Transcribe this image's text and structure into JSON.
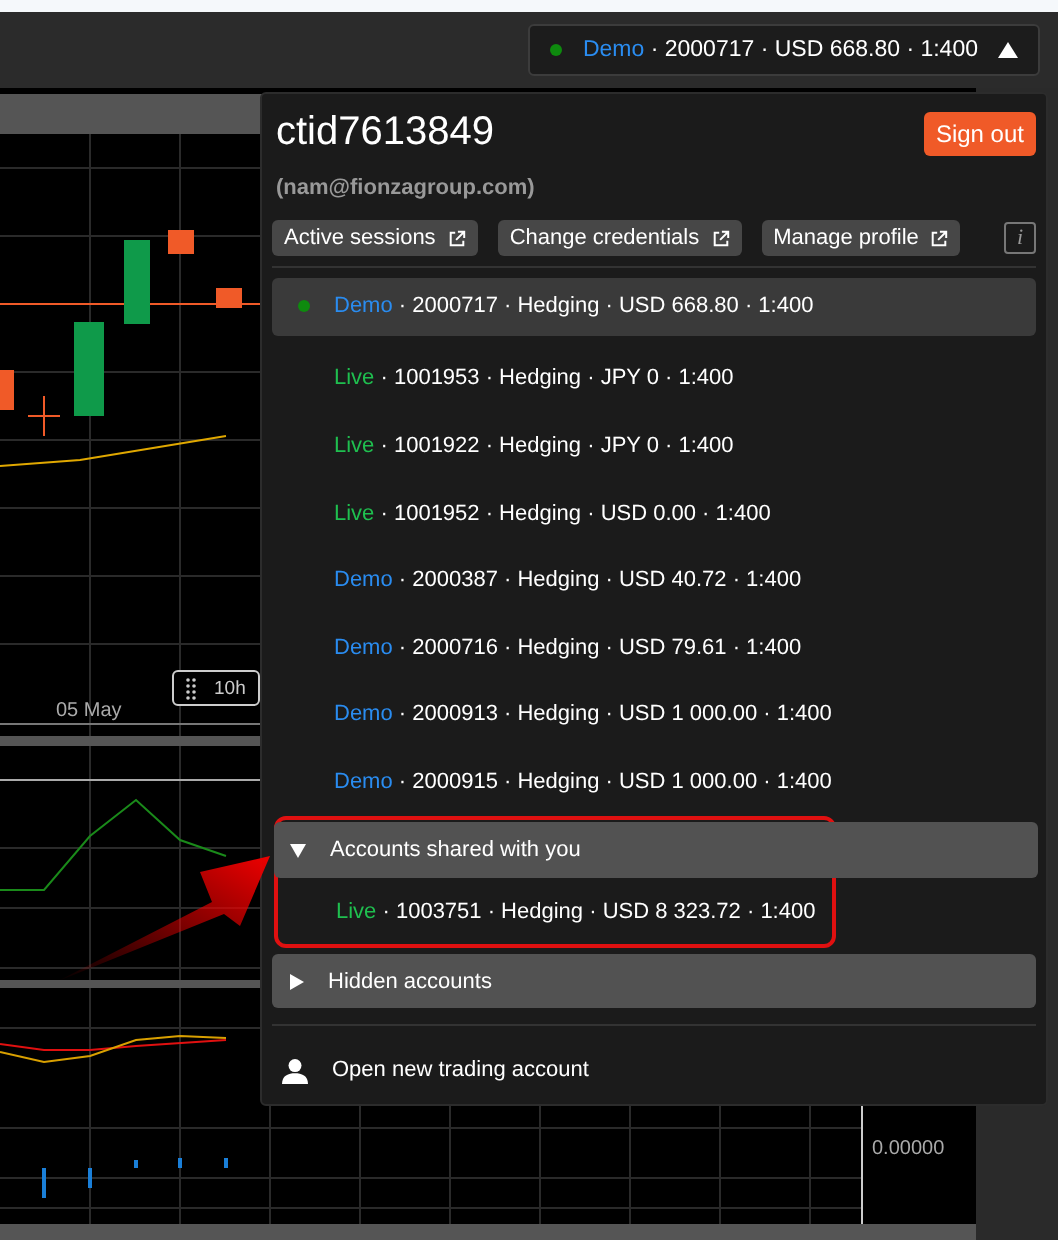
{
  "account_button": {
    "type": "Demo",
    "kind": "demo",
    "details": "· 2000717 · USD 668.80 · 1:400",
    "connected": true,
    "expanded": true
  },
  "profile": {
    "title": "ctid7613849",
    "email": "(nam@fionzagroup.com)",
    "sign_out": "Sign out",
    "links": [
      "Active sessions",
      "Change credentials",
      "Manage profile"
    ],
    "info": "i"
  },
  "accounts": [
    {
      "type": "Demo",
      "kind": "demo",
      "details": "· 2000717 · Hedging · USD 668.80 · 1:400",
      "selected": true
    },
    {
      "type": "Live",
      "kind": "live",
      "details": "· 1001953 · Hedging · JPY 0 · 1:400",
      "selected": false
    },
    {
      "type": "Live",
      "kind": "live",
      "details": "· 1001922 · Hedging · JPY 0 · 1:400",
      "selected": false
    },
    {
      "type": "Live",
      "kind": "live",
      "details": "· 1001952 · Hedging · USD 0.00 · 1:400",
      "selected": false
    },
    {
      "type": "Demo",
      "kind": "demo",
      "details": "· 2000387 · Hedging · USD 40.72 · 1:400",
      "selected": false
    },
    {
      "type": "Demo",
      "kind": "demo",
      "details": "· 2000716 · Hedging · USD 79.61 · 1:400",
      "selected": false
    },
    {
      "type": "Demo",
      "kind": "demo",
      "details": "· 2000913 · Hedging · USD 1 000.00 · 1:400",
      "selected": false
    },
    {
      "type": "Demo",
      "kind": "demo",
      "details": "· 2000915 · Hedging · USD 1 000.00 · 1:400",
      "selected": false
    }
  ],
  "sections": [
    {
      "label": "Accounts shared with you",
      "expanded": true,
      "accounts": [
        {
          "type": "Live",
          "kind": "live",
          "details": "· 1003751 · Hedging · USD 8 323.72 · 1:400",
          "selected": false
        }
      ]
    },
    {
      "label": "Hidden accounts",
      "expanded": false
    }
  ],
  "open_account": "Open new trading account",
  "chart": {
    "date_label": "05 May",
    "timeframe": "10h",
    "axis_value": "0.00000"
  }
}
